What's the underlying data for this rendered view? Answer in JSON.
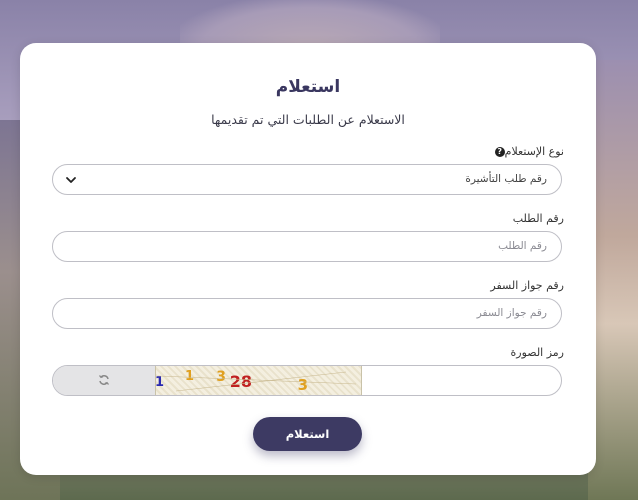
{
  "form": {
    "title": "استعلام",
    "subtitle": "الاستعلام عن الطلبات التي تم تقديمها",
    "inquiry_type": {
      "label": "نوع الإستعلام",
      "value": "رقم طلب التأشيرة"
    },
    "request_number": {
      "label": "رقم الطلب",
      "placeholder": "رقم الطلب"
    },
    "passport_number": {
      "label": "رقم جواز السفر",
      "placeholder": "رقم جواز السفر"
    },
    "captcha": {
      "label": "رمز الصورة",
      "image_text": "1 1 3 28 3"
    },
    "submit_label": "استعلام"
  },
  "icons": {
    "help": "question-circle-icon",
    "dropdown": "chevron-down-icon",
    "refresh": "refresh-icon"
  },
  "colors": {
    "accent": "#3d3a63",
    "card": "#ffffff",
    "border": "#bfbfc6"
  }
}
